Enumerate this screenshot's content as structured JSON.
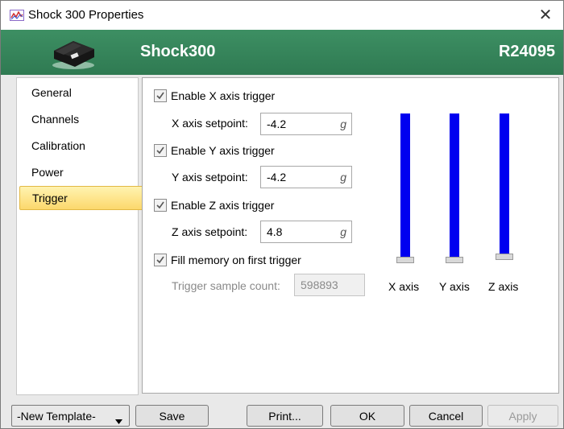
{
  "window": {
    "title": "Shock 300 Properties"
  },
  "header": {
    "device_name": "Shock300",
    "serial": "R24095"
  },
  "sidebar": {
    "items": [
      {
        "label": "General"
      },
      {
        "label": "Channels"
      },
      {
        "label": "Calibration"
      },
      {
        "label": "Power"
      },
      {
        "label": "Trigger",
        "active": true
      }
    ]
  },
  "trigger": {
    "x": {
      "enable_label": "Enable X axis trigger",
      "checked": true,
      "setpoint_label": "X axis setpoint:",
      "setpoint": "-4.2",
      "unit": "g"
    },
    "y": {
      "enable_label": "Enable Y axis trigger",
      "checked": true,
      "setpoint_label": "Y axis setpoint:",
      "setpoint": "-4.2",
      "unit": "g"
    },
    "z": {
      "enable_label": "Enable Z axis trigger",
      "checked": true,
      "setpoint_label": "Z axis setpoint:",
      "setpoint": "4.8",
      "unit": "g"
    },
    "fill_memory": {
      "label": "Fill memory on first trigger",
      "checked": true
    },
    "sample_count": {
      "label": "Trigger sample count:",
      "value": "598893"
    }
  },
  "axis_bars": {
    "labels": [
      "X axis",
      "Y axis",
      "Z axis"
    ],
    "color": "#0000f0"
  },
  "footer": {
    "template_select": "-New Template-",
    "save": "Save",
    "print": "Print...",
    "ok": "OK",
    "cancel": "Cancel",
    "apply": "Apply"
  }
}
